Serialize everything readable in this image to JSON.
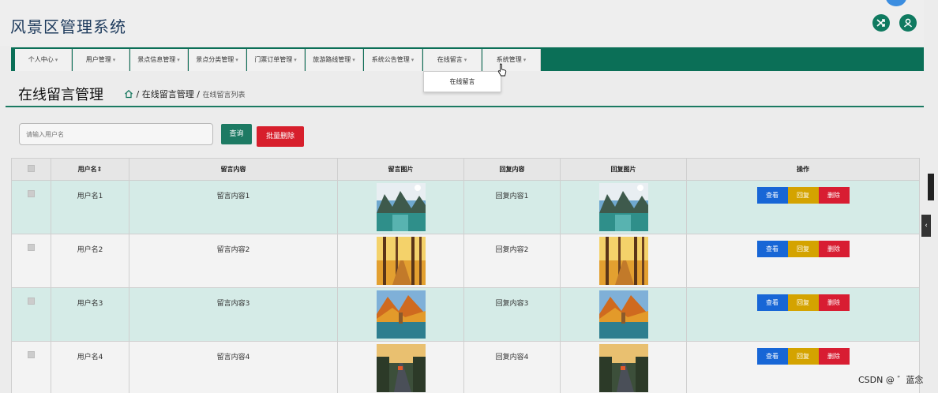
{
  "app": {
    "title": "风景区管理系统"
  },
  "header_icons": [
    "shuffle-icon",
    "user-icon"
  ],
  "nav": {
    "items": [
      {
        "label": "个人中心"
      },
      {
        "label": "用户管理"
      },
      {
        "label": "景点信息管理"
      },
      {
        "label": "景点分类管理"
      },
      {
        "label": "门票订单管理"
      },
      {
        "label": "旅游路线管理"
      },
      {
        "label": "系统公告管理"
      },
      {
        "label": "在线留言"
      },
      {
        "label": "系统管理"
      }
    ],
    "dropdown_item": "在线留言"
  },
  "page": {
    "title": "在线留言管理",
    "breadcrumb": {
      "sep": "/",
      "section": "在线留言管理",
      "current": "在线留言列表"
    }
  },
  "search": {
    "placeholder": "请输入用户名",
    "query_label": "查询",
    "batch_delete_label": "批量删除"
  },
  "table": {
    "headers": {
      "username": "用户名",
      "content": "留言内容",
      "image": "留言图片",
      "reply": "回复内容",
      "reply_image": "回复图片",
      "actions": "操作"
    },
    "rows": [
      {
        "username": "用户名1",
        "content": "留言内容1",
        "reply": "回复内容1",
        "image": "lake-mountain"
      },
      {
        "username": "用户名2",
        "content": "留言内容2",
        "reply": "回复内容2",
        "image": "autumn-forest"
      },
      {
        "username": "用户名3",
        "content": "留言内容3",
        "reply": "回复内容3",
        "image": "autumn-lake"
      },
      {
        "username": "用户名4",
        "content": "留言内容4",
        "reply": "回复内容4",
        "image": "road-sunset"
      }
    ],
    "actions": {
      "view": "查看",
      "reply": "回复",
      "delete": "删除"
    }
  },
  "watermark": "CSDN @ ゛蓝念",
  "colors": {
    "primary": "#0b6f57",
    "view": "#1766d6",
    "reply": "#d4a300",
    "delete": "#d81d32",
    "row_highlight": "#d5ebe7"
  }
}
